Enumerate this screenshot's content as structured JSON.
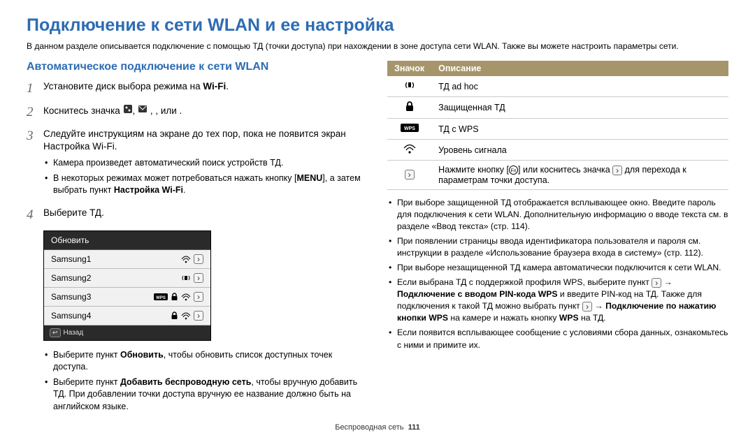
{
  "title": "Подключение к сети WLAN и ее настройка",
  "intro": "В данном разделе описывается подключение с помощью ТД (точки доступа) при нахождении в зоне доступа сети WLAN. Также вы можете настроить параметры сети.",
  "section_heading": "Автоматическое подключение к сети WLAN",
  "steps": {
    "s1": {
      "num": "1",
      "a": "Установите диск выбора режима на ",
      "wifi": "Wi-Fi",
      "b": "."
    },
    "s2": {
      "num": "2",
      "a": "Коснитесь значка ",
      "mid": ", ",
      "c": ",   ,   или   ."
    },
    "s3": {
      "num": "3",
      "text": "Следуйте инструкциям на экране до тех пор, пока не появится экран Настройка Wi-Fi.",
      "b1": "Камера произведет автоматический поиск устройств ТД.",
      "b2a": "В некоторых режимах может потребоваться нажать кнопку [",
      "menu": "MENU",
      "b2b": "], а затем выбрать пункт ",
      "b2bold": "Настройка Wi-Fi",
      "b2c": "."
    },
    "s4": {
      "num": "4",
      "text": "Выберите ТД."
    }
  },
  "ap_box": {
    "header": "Обновить",
    "rows": [
      "Samsung1",
      "Samsung2",
      "Samsung3",
      "Samsung4"
    ],
    "back": "Назад"
  },
  "left_bullets": {
    "l1a": "Выберите пункт ",
    "l1bold": "Обновить",
    "l1b": ", чтобы обновить список доступных точек доступа.",
    "l2a": "Выберите пункт ",
    "l2bold": "Добавить беспроводную сеть",
    "l2b": ", чтобы вручную добавить ТД. При добавлении точки доступа вручную ее название должно быть на английском языке."
  },
  "icon_table": {
    "h_icon": "Значок",
    "h_desc": "Описание",
    "r1": "ТД ad hoc",
    "r2": "Защищенная ТД",
    "r3": "ТД с WPS",
    "r4": "Уровень сигнала",
    "r5a": "Нажмите кнопку [",
    "r5b": "] или коснитесь значка ",
    "r5c": " для перехода к параметрам точки доступа."
  },
  "right_bullets": {
    "b1": "При выборе защищенной ТД отображается всплывающее окно. Введите пароль для подключения к сети WLAN. Дополнительную информацию о вводе текста см. в разделе «Ввод текста» (стр. 114).",
    "b2": "При появлении страницы ввода идентификатора пользователя и пароля см. инструкции в разделе «Использование браузера входа в систему» (стр. 112).",
    "b3": "При выборе незащищенной ТД камера автоматически подключится к сети WLAN.",
    "b4a": "Если выбрана ТД с поддержкой профиля WPS, выберите пункт ",
    "b4arrow": " → ",
    "b4bold1": "Подключение с вводом PIN-кода WPS",
    "b4b": " и введите PIN-код на ТД. Также для подключения к такой ТД можно выбрать пункт ",
    "b4bold2": "Подключение по нажатию кнопки WPS",
    "b4c": " на камере и нажать кнопку ",
    "b4bold3": "WPS",
    "b4d": " на ТД.",
    "b5": "Если появится всплывающее сообщение с условиями сбора данных, ознакомьтесь с ними и примите их."
  },
  "footer": {
    "section": "Беспроводная сеть",
    "page": "111"
  }
}
